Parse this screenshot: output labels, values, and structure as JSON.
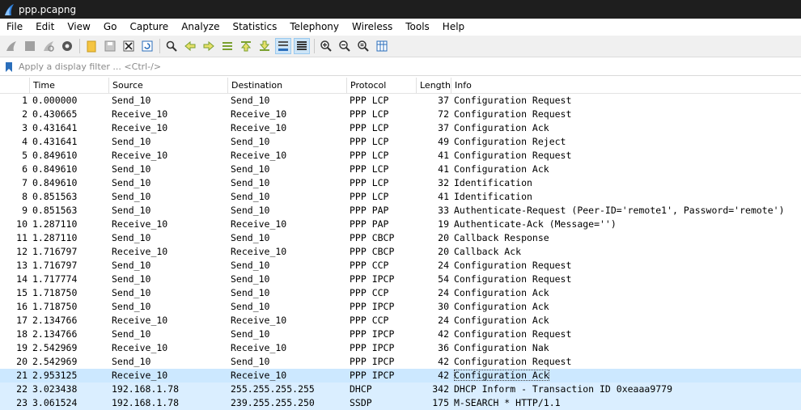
{
  "window": {
    "title": "ppp.pcapng"
  },
  "menu": [
    "File",
    "Edit",
    "View",
    "Go",
    "Capture",
    "Analyze",
    "Statistics",
    "Telephony",
    "Wireless",
    "Tools",
    "Help"
  ],
  "toolbar": {
    "icons": [
      "shark-fin-start-icon",
      "stop-icon",
      "restart-icon",
      "options-gear-icon",
      "open-folder-icon",
      "save-file-icon",
      "close-file-icon",
      "reload-icon",
      "find-magnifier-icon",
      "back-arrow-icon",
      "forward-arrow-icon",
      "go-to-packet-icon",
      "first-packet-icon",
      "last-packet-icon",
      "autoscroll-icon",
      "colorize-icon",
      "zoom-in-icon",
      "zoom-out-icon",
      "zoom-normal-icon",
      "resize-columns-icon"
    ]
  },
  "filter": {
    "placeholder": "Apply a display filter ... <Ctrl-/>"
  },
  "columns": {
    "no": "",
    "time": "Time",
    "source": "Source",
    "destination": "Destination",
    "protocol": "Protocol",
    "length": "Length",
    "info": "Info"
  },
  "packets": [
    {
      "no": "1",
      "time": "0.000000",
      "src": "Send_10",
      "dst": "Send_10",
      "proto": "PPP LCP",
      "len": "37",
      "info": "Configuration Request",
      "style": "ppp"
    },
    {
      "no": "2",
      "time": "0.430665",
      "src": "Receive_10",
      "dst": "Receive_10",
      "proto": "PPP LCP",
      "len": "72",
      "info": "Configuration Request",
      "style": "ppp"
    },
    {
      "no": "3",
      "time": "0.431641",
      "src": "Receive_10",
      "dst": "Receive_10",
      "proto": "PPP LCP",
      "len": "37",
      "info": "Configuration Ack",
      "style": "ppp"
    },
    {
      "no": "4",
      "time": "0.431641",
      "src": "Send_10",
      "dst": "Send_10",
      "proto": "PPP LCP",
      "len": "49",
      "info": "Configuration Reject",
      "style": "ppp"
    },
    {
      "no": "5",
      "time": "0.849610",
      "src": "Receive_10",
      "dst": "Receive_10",
      "proto": "PPP LCP",
      "len": "41",
      "info": "Configuration Request",
      "style": "ppp"
    },
    {
      "no": "6",
      "time": "0.849610",
      "src": "Send_10",
      "dst": "Send_10",
      "proto": "PPP LCP",
      "len": "41",
      "info": "Configuration Ack",
      "style": "ppp"
    },
    {
      "no": "7",
      "time": "0.849610",
      "src": "Send_10",
      "dst": "Send_10",
      "proto": "PPP LCP",
      "len": "32",
      "info": "Identification",
      "style": "ppp"
    },
    {
      "no": "8",
      "time": "0.851563",
      "src": "Send_10",
      "dst": "Send_10",
      "proto": "PPP LCP",
      "len": "41",
      "info": "Identification",
      "style": "ppp"
    },
    {
      "no": "9",
      "time": "0.851563",
      "src": "Send_10",
      "dst": "Send_10",
      "proto": "PPP PAP",
      "len": "33",
      "info": "Authenticate-Request (Peer-ID='remote1', Password='remote')",
      "style": "ppp"
    },
    {
      "no": "10",
      "time": "1.287110",
      "src": "Receive_10",
      "dst": "Receive_10",
      "proto": "PPP PAP",
      "len": "19",
      "info": "Authenticate-Ack (Message='')",
      "style": "ppp"
    },
    {
      "no": "11",
      "time": "1.287110",
      "src": "Send_10",
      "dst": "Send_10",
      "proto": "PPP CBCP",
      "len": "20",
      "info": "Callback Response",
      "style": "ppp"
    },
    {
      "no": "12",
      "time": "1.716797",
      "src": "Receive_10",
      "dst": "Receive_10",
      "proto": "PPP CBCP",
      "len": "20",
      "info": "Callback Ack",
      "style": "ppp"
    },
    {
      "no": "13",
      "time": "1.716797",
      "src": "Send_10",
      "dst": "Send_10",
      "proto": "PPP CCP",
      "len": "24",
      "info": "Configuration Request",
      "style": "ppp"
    },
    {
      "no": "14",
      "time": "1.717774",
      "src": "Send_10",
      "dst": "Send_10",
      "proto": "PPP IPCP",
      "len": "54",
      "info": "Configuration Request",
      "style": "ppp"
    },
    {
      "no": "15",
      "time": "1.718750",
      "src": "Send_10",
      "dst": "Send_10",
      "proto": "PPP CCP",
      "len": "24",
      "info": "Configuration Ack",
      "style": "ppp"
    },
    {
      "no": "16",
      "time": "1.718750",
      "src": "Send_10",
      "dst": "Send_10",
      "proto": "PPP IPCP",
      "len": "30",
      "info": "Configuration Ack",
      "style": "ppp"
    },
    {
      "no": "17",
      "time": "2.134766",
      "src": "Receive_10",
      "dst": "Receive_10",
      "proto": "PPP CCP",
      "len": "24",
      "info": "Configuration Ack",
      "style": "ppp"
    },
    {
      "no": "18",
      "time": "2.134766",
      "src": "Send_10",
      "dst": "Send_10",
      "proto": "PPP IPCP",
      "len": "42",
      "info": "Configuration Request",
      "style": "ppp"
    },
    {
      "no": "19",
      "time": "2.542969",
      "src": "Receive_10",
      "dst": "Receive_10",
      "proto": "PPP IPCP",
      "len": "36",
      "info": "Configuration Nak",
      "style": "ppp"
    },
    {
      "no": "20",
      "time": "2.542969",
      "src": "Send_10",
      "dst": "Send_10",
      "proto": "PPP IPCP",
      "len": "42",
      "info": "Configuration Request",
      "style": "ppp"
    },
    {
      "no": "21",
      "time": "2.953125",
      "src": "Receive_10",
      "dst": "Receive_10",
      "proto": "PPP IPCP",
      "len": "42",
      "info": "Configuration Ack",
      "style": "sel"
    },
    {
      "no": "22",
      "time": "3.023438",
      "src": "192.168.1.78",
      "dst": "255.255.255.255",
      "proto": "DHCP",
      "len": "342",
      "info": "DHCP Inform   - Transaction ID 0xeaaa9779",
      "style": "udp"
    },
    {
      "no": "23",
      "time": "3.061524",
      "src": "192.168.1.78",
      "dst": "239.255.255.250",
      "proto": "SSDP",
      "len": "175",
      "info": "M-SEARCH * HTTP/1.1",
      "style": "udp"
    }
  ]
}
